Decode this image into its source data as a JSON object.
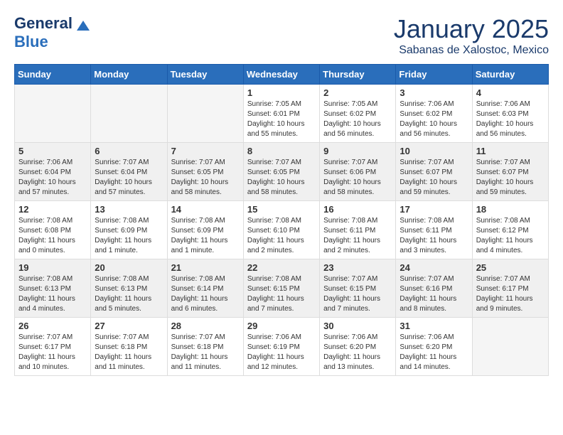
{
  "header": {
    "logo_general": "General",
    "logo_blue": "Blue",
    "month": "January 2025",
    "location": "Sabanas de Xalostoc, Mexico"
  },
  "weekdays": [
    "Sunday",
    "Monday",
    "Tuesday",
    "Wednesday",
    "Thursday",
    "Friday",
    "Saturday"
  ],
  "weeks": [
    [
      {
        "day": "",
        "empty": true
      },
      {
        "day": "",
        "empty": true
      },
      {
        "day": "",
        "empty": true
      },
      {
        "day": "1",
        "sunrise": "7:05 AM",
        "sunset": "6:01 PM",
        "daylight": "10 hours and 55 minutes."
      },
      {
        "day": "2",
        "sunrise": "7:05 AM",
        "sunset": "6:02 PM",
        "daylight": "10 hours and 56 minutes."
      },
      {
        "day": "3",
        "sunrise": "7:06 AM",
        "sunset": "6:02 PM",
        "daylight": "10 hours and 56 minutes."
      },
      {
        "day": "4",
        "sunrise": "7:06 AM",
        "sunset": "6:03 PM",
        "daylight": "10 hours and 56 minutes."
      }
    ],
    [
      {
        "day": "5",
        "sunrise": "7:06 AM",
        "sunset": "6:04 PM",
        "daylight": "10 hours and 57 minutes."
      },
      {
        "day": "6",
        "sunrise": "7:07 AM",
        "sunset": "6:04 PM",
        "daylight": "10 hours and 57 minutes."
      },
      {
        "day": "7",
        "sunrise": "7:07 AM",
        "sunset": "6:05 PM",
        "daylight": "10 hours and 58 minutes."
      },
      {
        "day": "8",
        "sunrise": "7:07 AM",
        "sunset": "6:05 PM",
        "daylight": "10 hours and 58 minutes."
      },
      {
        "day": "9",
        "sunrise": "7:07 AM",
        "sunset": "6:06 PM",
        "daylight": "10 hours and 58 minutes."
      },
      {
        "day": "10",
        "sunrise": "7:07 AM",
        "sunset": "6:07 PM",
        "daylight": "10 hours and 59 minutes."
      },
      {
        "day": "11",
        "sunrise": "7:07 AM",
        "sunset": "6:07 PM",
        "daylight": "10 hours and 59 minutes."
      }
    ],
    [
      {
        "day": "12",
        "sunrise": "7:08 AM",
        "sunset": "6:08 PM",
        "daylight": "11 hours and 0 minutes."
      },
      {
        "day": "13",
        "sunrise": "7:08 AM",
        "sunset": "6:09 PM",
        "daylight": "11 hours and 1 minute."
      },
      {
        "day": "14",
        "sunrise": "7:08 AM",
        "sunset": "6:09 PM",
        "daylight": "11 hours and 1 minute."
      },
      {
        "day": "15",
        "sunrise": "7:08 AM",
        "sunset": "6:10 PM",
        "daylight": "11 hours and 2 minutes."
      },
      {
        "day": "16",
        "sunrise": "7:08 AM",
        "sunset": "6:11 PM",
        "daylight": "11 hours and 2 minutes."
      },
      {
        "day": "17",
        "sunrise": "7:08 AM",
        "sunset": "6:11 PM",
        "daylight": "11 hours and 3 minutes."
      },
      {
        "day": "18",
        "sunrise": "7:08 AM",
        "sunset": "6:12 PM",
        "daylight": "11 hours and 4 minutes."
      }
    ],
    [
      {
        "day": "19",
        "sunrise": "7:08 AM",
        "sunset": "6:13 PM",
        "daylight": "11 hours and 4 minutes."
      },
      {
        "day": "20",
        "sunrise": "7:08 AM",
        "sunset": "6:13 PM",
        "daylight": "11 hours and 5 minutes."
      },
      {
        "day": "21",
        "sunrise": "7:08 AM",
        "sunset": "6:14 PM",
        "daylight": "11 hours and 6 minutes."
      },
      {
        "day": "22",
        "sunrise": "7:08 AM",
        "sunset": "6:15 PM",
        "daylight": "11 hours and 7 minutes."
      },
      {
        "day": "23",
        "sunrise": "7:07 AM",
        "sunset": "6:15 PM",
        "daylight": "11 hours and 7 minutes."
      },
      {
        "day": "24",
        "sunrise": "7:07 AM",
        "sunset": "6:16 PM",
        "daylight": "11 hours and 8 minutes."
      },
      {
        "day": "25",
        "sunrise": "7:07 AM",
        "sunset": "6:17 PM",
        "daylight": "11 hours and 9 minutes."
      }
    ],
    [
      {
        "day": "26",
        "sunrise": "7:07 AM",
        "sunset": "6:17 PM",
        "daylight": "11 hours and 10 minutes."
      },
      {
        "day": "27",
        "sunrise": "7:07 AM",
        "sunset": "6:18 PM",
        "daylight": "11 hours and 11 minutes."
      },
      {
        "day": "28",
        "sunrise": "7:07 AM",
        "sunset": "6:18 PM",
        "daylight": "11 hours and 11 minutes."
      },
      {
        "day": "29",
        "sunrise": "7:06 AM",
        "sunset": "6:19 PM",
        "daylight": "11 hours and 12 minutes."
      },
      {
        "day": "30",
        "sunrise": "7:06 AM",
        "sunset": "6:20 PM",
        "daylight": "11 hours and 13 minutes."
      },
      {
        "day": "31",
        "sunrise": "7:06 AM",
        "sunset": "6:20 PM",
        "daylight": "11 hours and 14 minutes."
      },
      {
        "day": "",
        "empty": true
      }
    ]
  ]
}
